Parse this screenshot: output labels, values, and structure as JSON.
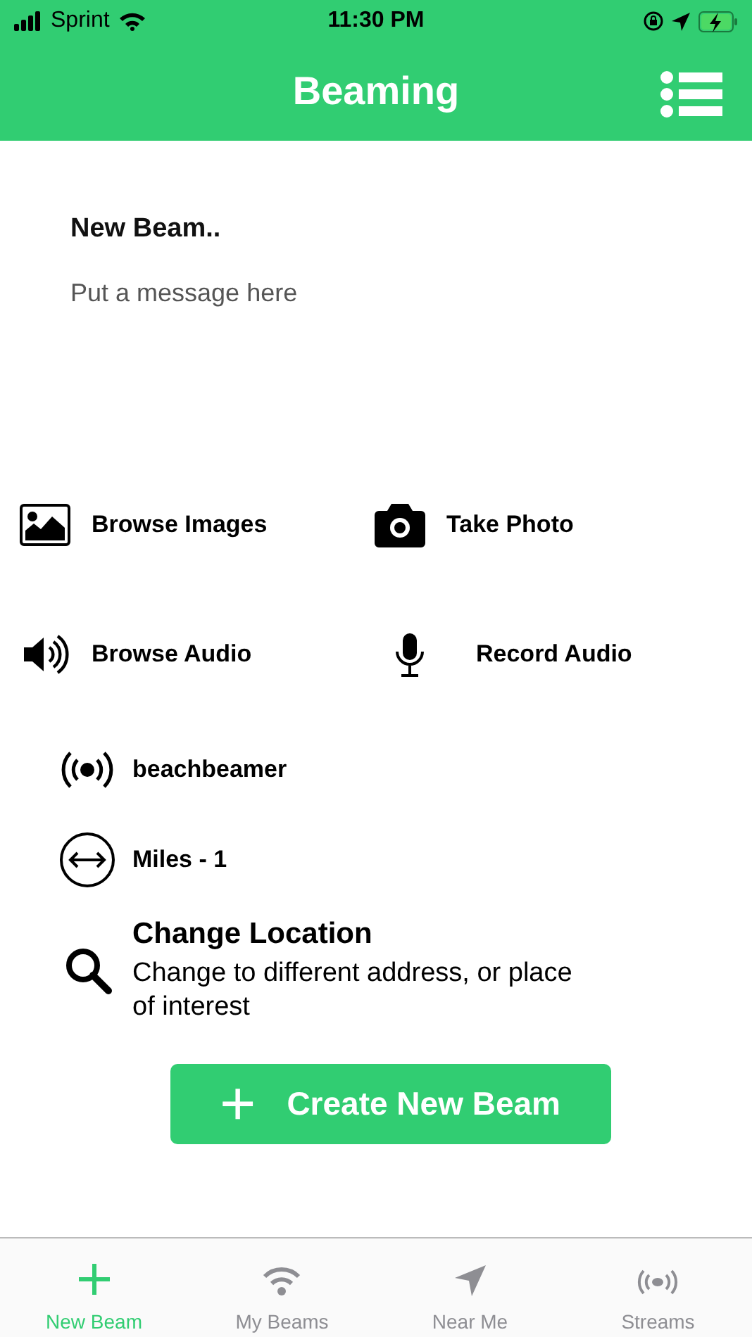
{
  "status_bar": {
    "carrier": "Sprint",
    "time": "11:30 PM"
  },
  "nav": {
    "title": "Beaming"
  },
  "compose": {
    "title": "New Beam..",
    "placeholder": "Put a message here"
  },
  "media": [
    {
      "kind": "images",
      "label": "Browse Images"
    },
    {
      "kind": "camera",
      "label": "Take Photo"
    },
    {
      "kind": "audio",
      "label": "Browse Audio"
    },
    {
      "kind": "mic",
      "label": "Record Audio"
    }
  ],
  "info": [
    {
      "kind": "broadcast",
      "label": "beachbeamer"
    },
    {
      "kind": "distance",
      "label": "Miles - 1"
    }
  ],
  "location": {
    "title": "Change Location",
    "description": "Change to different address, or place of interest"
  },
  "create_button": {
    "icon": "+",
    "label": "Create New Beam"
  },
  "tabs": [
    {
      "kind": "plus",
      "label": "New Beam",
      "selected": true
    },
    {
      "kind": "wifi",
      "label": "My Beams",
      "selected": false
    },
    {
      "kind": "arrow",
      "label": "Near Me",
      "selected": false
    },
    {
      "kind": "broadcast",
      "label": "Streams",
      "selected": false
    }
  ]
}
